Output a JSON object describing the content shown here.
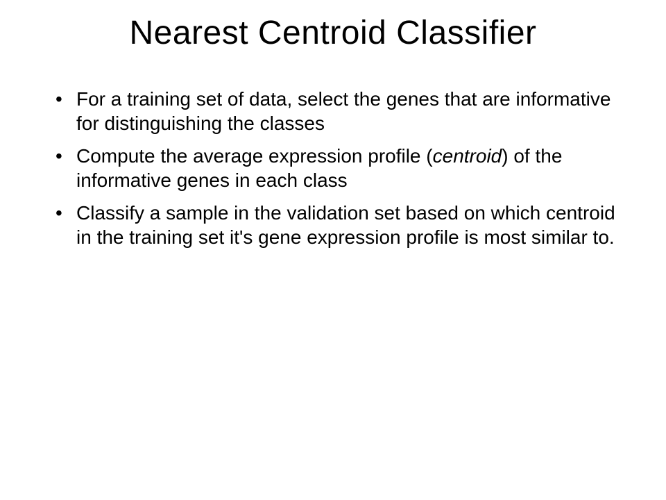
{
  "slide": {
    "title": "Nearest Centroid Classifier",
    "bullets": [
      {
        "text": "For a training set of data, select the genes that are informative for distinguishing the classes"
      },
      {
        "prefix": "Compute the average expression profile (",
        "italic": "centroid",
        "suffix": ") of the informative genes in each class"
      },
      {
        "text": "Classify a sample in the validation set based on which centroid in the training set it's gene expression profile is most similar to."
      }
    ]
  }
}
